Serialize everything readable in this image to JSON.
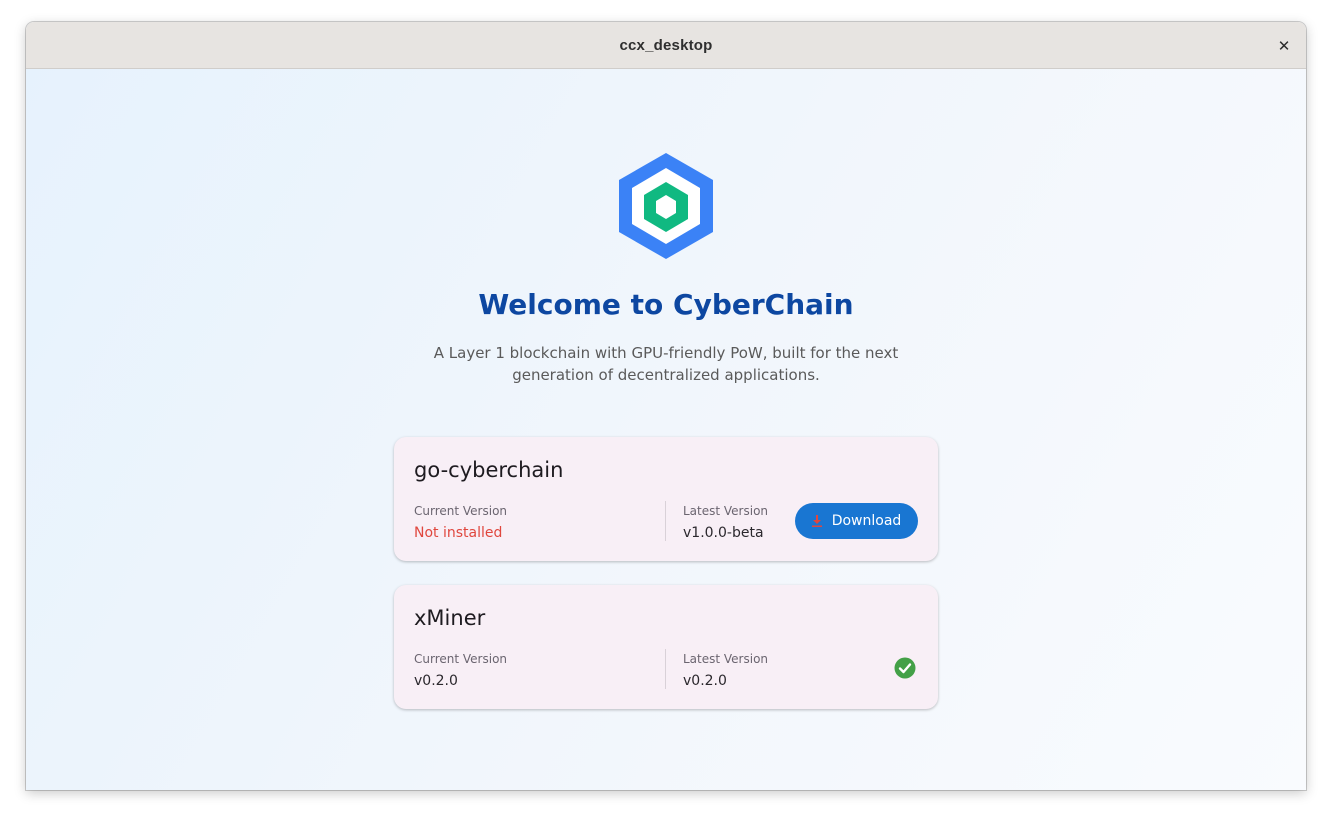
{
  "window": {
    "title": "ccx_desktop",
    "close_glyph": "✕"
  },
  "logo": {
    "icon": "cyberchain-hexagon-logo",
    "outer_color": "#3b82f6",
    "inner_color": "#10b981"
  },
  "hero": {
    "title": "Welcome to CyberChain",
    "subtitle_line1": "A Layer 1 blockchain with GPU-friendly PoW, built for the next",
    "subtitle_line2": "generation of decentralized applications."
  },
  "components": [
    {
      "name": "go-cyberchain",
      "current_label": "Current Version",
      "current_value": "Not installed",
      "latest_label": "Latest Version",
      "latest_value": "v1.0.0-beta",
      "action": {
        "label": "Download",
        "icon": "download-icon",
        "color": "#1976d2"
      }
    },
    {
      "name": "xMiner",
      "current_label": "Current Version",
      "current_value": "v0.2.0",
      "latest_label": "Latest Version",
      "latest_value": "v0.2.0",
      "status_icon": "check-circle-icon",
      "status_color": "#43a047"
    }
  ]
}
